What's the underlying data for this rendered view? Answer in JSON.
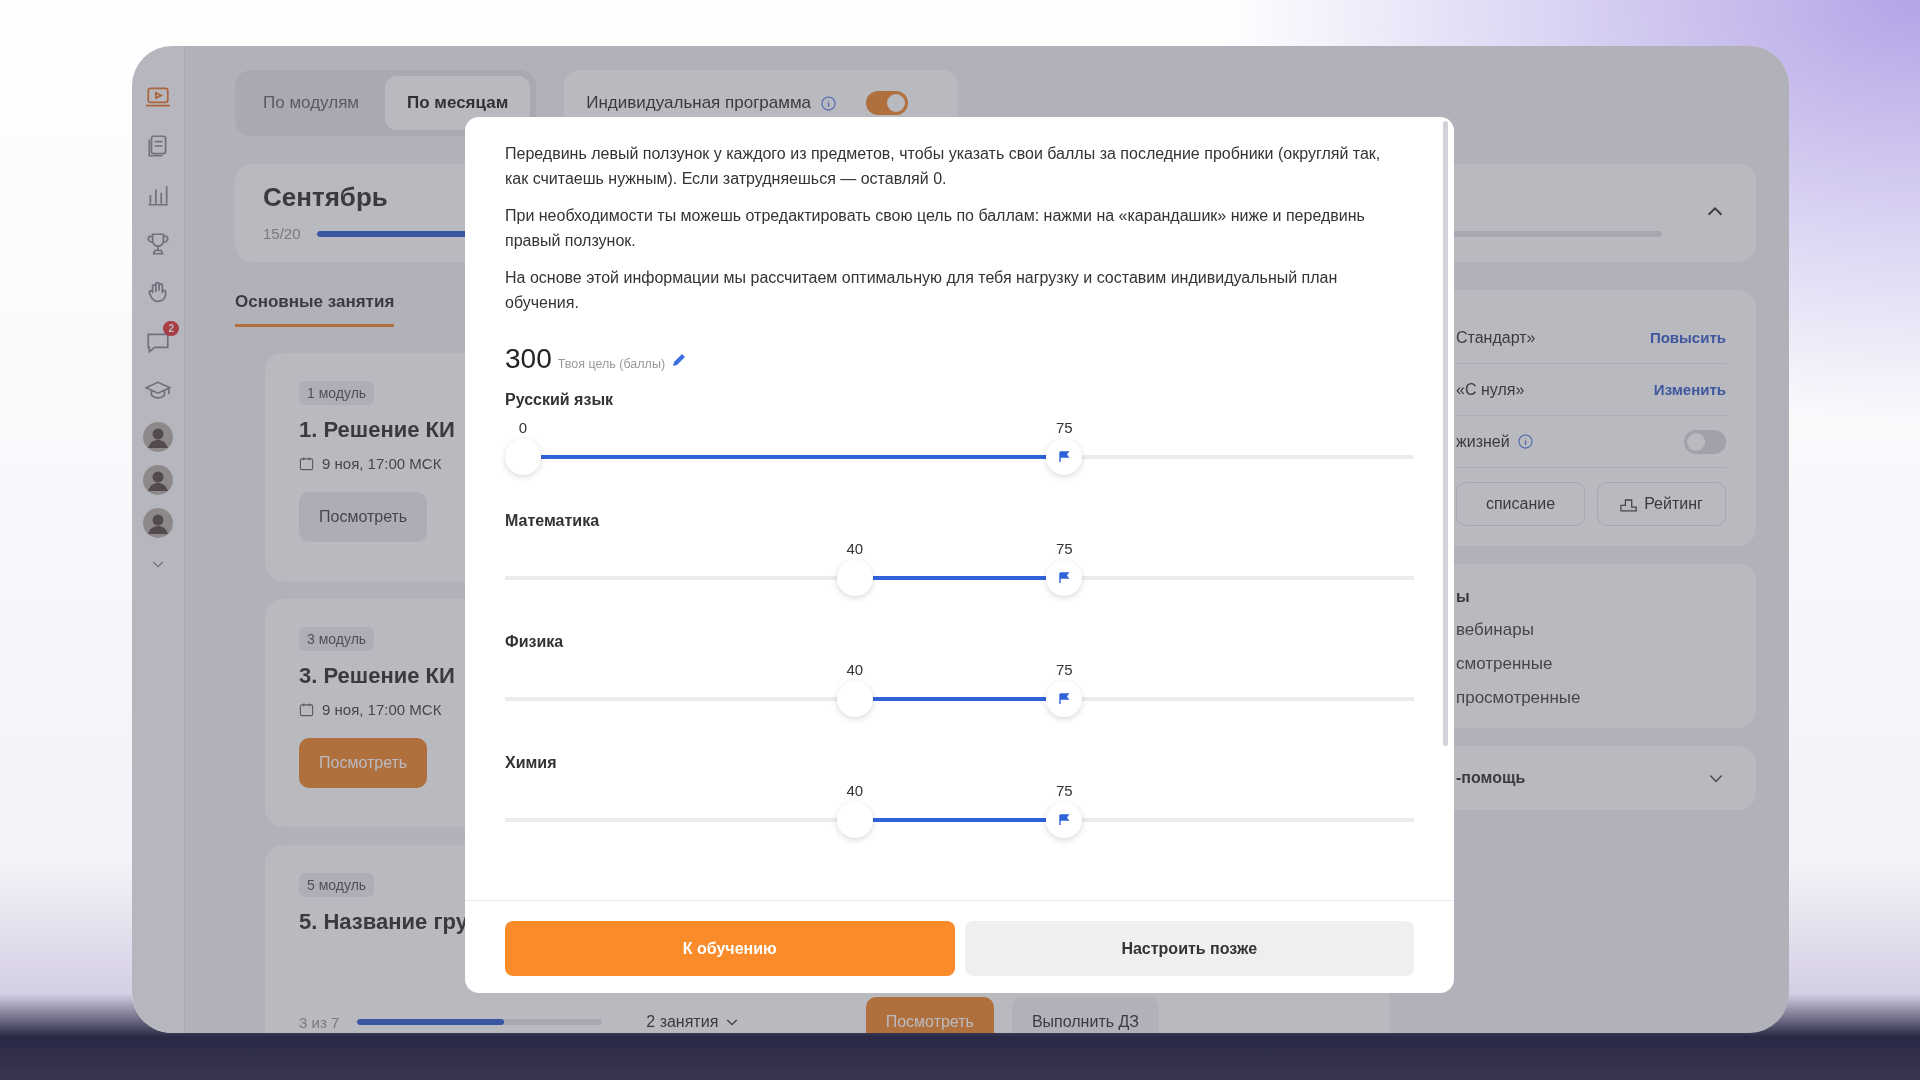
{
  "sidebar": {
    "items": [
      {
        "kind": "lesson",
        "selected": true
      },
      {
        "kind": "notes",
        "selected": false
      },
      {
        "kind": "stats",
        "selected": false
      },
      {
        "kind": "trophy",
        "selected": false
      },
      {
        "kind": "hand",
        "selected": false
      },
      {
        "kind": "chat",
        "selected": false,
        "badge": "2"
      },
      {
        "kind": "course",
        "selected": false
      },
      {
        "kind": "avatar",
        "selected": false
      },
      {
        "kind": "avatar",
        "selected": false
      },
      {
        "kind": "avatar",
        "selected": false
      },
      {
        "kind": "more",
        "selected": false
      }
    ]
  },
  "view_tabs": [
    {
      "label": "По модулям",
      "selected": false
    },
    {
      "label": "По месяцам",
      "selected": true
    }
  ],
  "individual_program": {
    "label": "Индивидуальная программа",
    "on": true
  },
  "month": {
    "title": "Сентябрь",
    "progress": "15/20",
    "level": 0.75,
    "expanded": true
  },
  "lesson_tabs": [
    {
      "label": "Основные занятия",
      "selected": true
    }
  ],
  "modules": [
    {
      "badge": "1 модуль",
      "title": "1. Решение КИ",
      "date": "9 ноя, 17:00 МСК",
      "buttons": [
        {
          "label": "Посмотреть",
          "primary": false
        }
      ]
    },
    {
      "badge": "3 модуль",
      "title": "3. Решение КИ",
      "date": "9 ноя, 17:00 МСК",
      "buttons": [
        {
          "label": "Посмотреть",
          "primary": true
        }
      ]
    },
    {
      "badge": "5 модуль",
      "title": "5. Название гру",
      "progress": "3 из 7",
      "level": 0.6,
      "lessons": "2 занятия",
      "buttons": [
        {
          "label": "Посмотреть",
          "primary": true
        },
        {
          "label": "Выполнить ДЗ",
          "primary": false
        }
      ]
    }
  ],
  "tariff": {
    "rows": [
      {
        "kind": "link",
        "label": "Стандарт»",
        "action": "Повысить"
      },
      {
        "kind": "link",
        "label": "«С нуля»",
        "action": "Изменить"
      },
      {
        "kind": "toggle",
        "label": "жизней",
        "on": false
      }
    ],
    "buttons": [
      "списание",
      "Рейтинг"
    ]
  },
  "webinars": {
    "heading": "ы",
    "items": [
      "вебинары",
      "смотренные",
      "просмотренные"
    ]
  },
  "help": {
    "title": "-помощь",
    "expanded": false
  },
  "modal": {
    "paragraphs": [
      "Передвинь левый ползунок у каждого из предметов, чтобы указать свои баллы за последние пробники (округляй так, как считаешь нужным). Если затрудняешься — оставляй 0.",
      "При необходимости ты можешь отредактировать свою цель по баллам: нажми на «карандашик» ниже и передвинь правый ползунок.",
      "На основе этой информации мы рассчитаем оптимальную для тебя нагрузку и составим индивидуальный план обучения."
    ],
    "goal": {
      "value": "300",
      "label": "Твоя цель (баллы)"
    },
    "subjects": [
      {
        "name": "Русский язык",
        "from": {
          "label": "0",
          "level": 0
        },
        "to": {
          "label": "75",
          "level": 0.62
        }
      },
      {
        "name": "Математика",
        "from": {
          "label": "40",
          "level": 0.38
        },
        "to": {
          "label": "75",
          "level": 0.62
        }
      },
      {
        "name": "Физика",
        "from": {
          "label": "40",
          "level": 0.38
        },
        "to": {
          "label": "75",
          "level": 0.62
        }
      },
      {
        "name": "Химия",
        "from": {
          "label": "40",
          "level": 0.38
        },
        "to": {
          "label": "75",
          "level": 0.62
        }
      }
    ],
    "buttons": [
      {
        "label": "К обучению",
        "primary": true
      },
      {
        "label": "Настроить позже",
        "primary": false
      }
    ]
  }
}
